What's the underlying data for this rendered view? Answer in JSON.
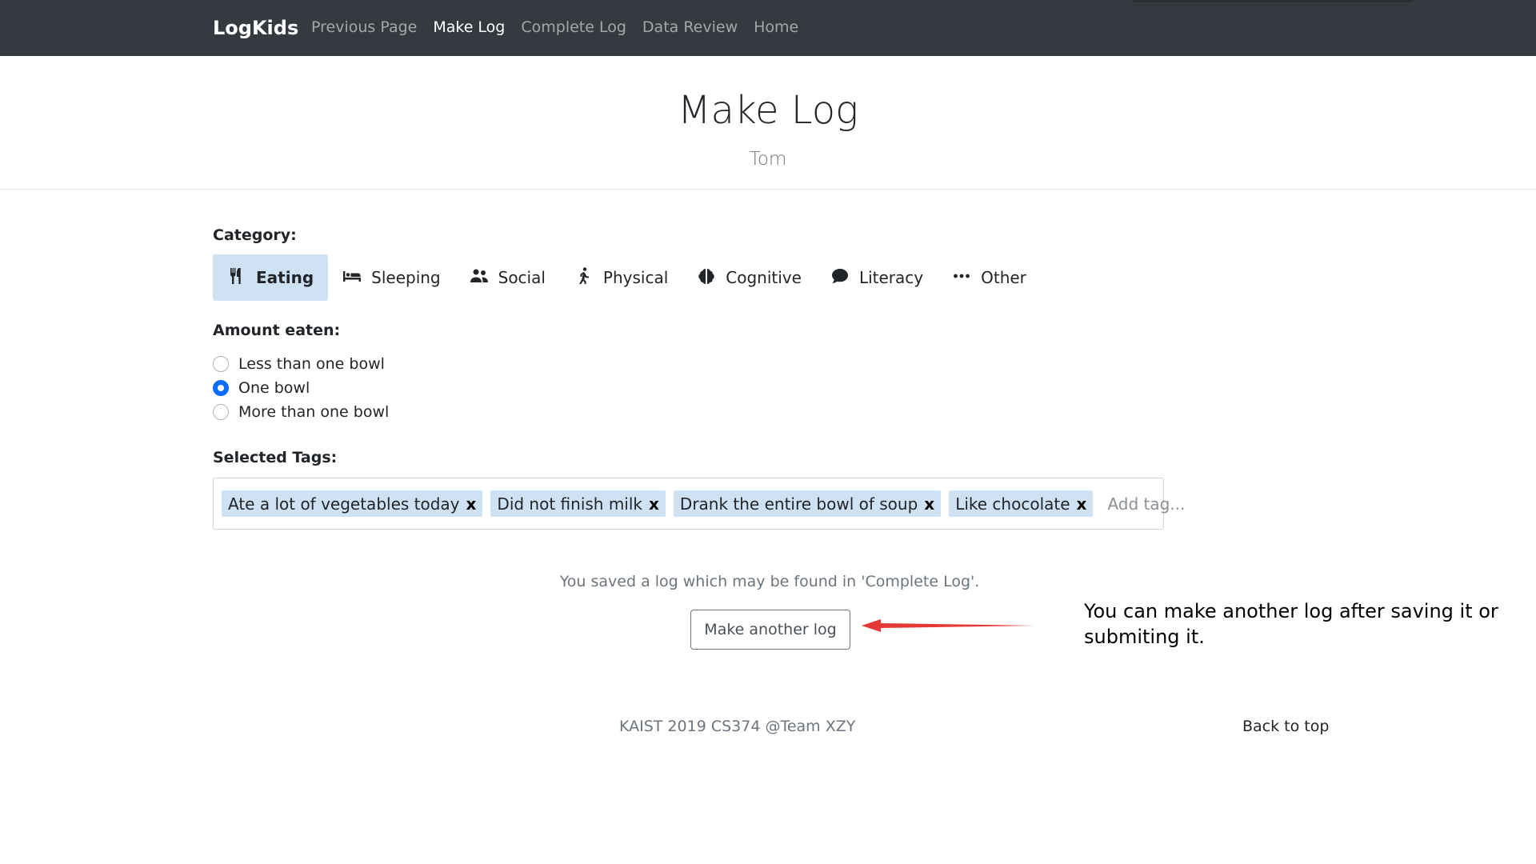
{
  "navbar": {
    "brand": "LogKids",
    "items": [
      {
        "label": "Previous Page",
        "active": false
      },
      {
        "label": "Make Log",
        "active": true
      },
      {
        "label": "Complete Log",
        "active": false
      },
      {
        "label": "Data Review",
        "active": false
      },
      {
        "label": "Home",
        "active": false
      }
    ]
  },
  "header": {
    "title": "Make Log",
    "subtitle": "Tom"
  },
  "form": {
    "category_label": "Category:",
    "categories": [
      {
        "label": "Eating",
        "icon": "utensils-icon",
        "selected": true
      },
      {
        "label": "Sleeping",
        "icon": "bed-icon",
        "selected": false
      },
      {
        "label": "Social",
        "icon": "users-icon",
        "selected": false
      },
      {
        "label": "Physical",
        "icon": "walking-icon",
        "selected": false
      },
      {
        "label": "Cognitive",
        "icon": "brain-icon",
        "selected": false
      },
      {
        "label": "Literacy",
        "icon": "comment-icon",
        "selected": false
      },
      {
        "label": "Other",
        "icon": "ellipsis-icon",
        "selected": false
      }
    ],
    "amount_label": "Amount eaten:",
    "amount_options": [
      {
        "label": "Less than one bowl",
        "checked": false
      },
      {
        "label": "One bowl",
        "checked": true
      },
      {
        "label": "More than one bowl",
        "checked": false
      }
    ],
    "tags_label": "Selected Tags:",
    "tags": [
      {
        "label": "Ate a lot of vegetables today"
      },
      {
        "label": "Did not finish milk"
      },
      {
        "label": "Drank the entire bowl of soup"
      },
      {
        "label": "Like chocolate"
      }
    ],
    "tag_remove": "x",
    "tag_placeholder": "Add tag..."
  },
  "status": {
    "saved_message": "You saved a log which may be found in 'Complete Log'.",
    "another_button": "Make another log"
  },
  "annotation": {
    "text": "You can make another log after saving it or submiting it.",
    "arrow_color": "#e53935"
  },
  "footer": {
    "credit": "KAIST 2019 CS374 @Team XZY",
    "back_to_top": "Back to top"
  },
  "colors": {
    "navbar_bg": "#343a40",
    "selected_bg": "#cfe2f3",
    "radio_accent": "#0d6efd"
  }
}
